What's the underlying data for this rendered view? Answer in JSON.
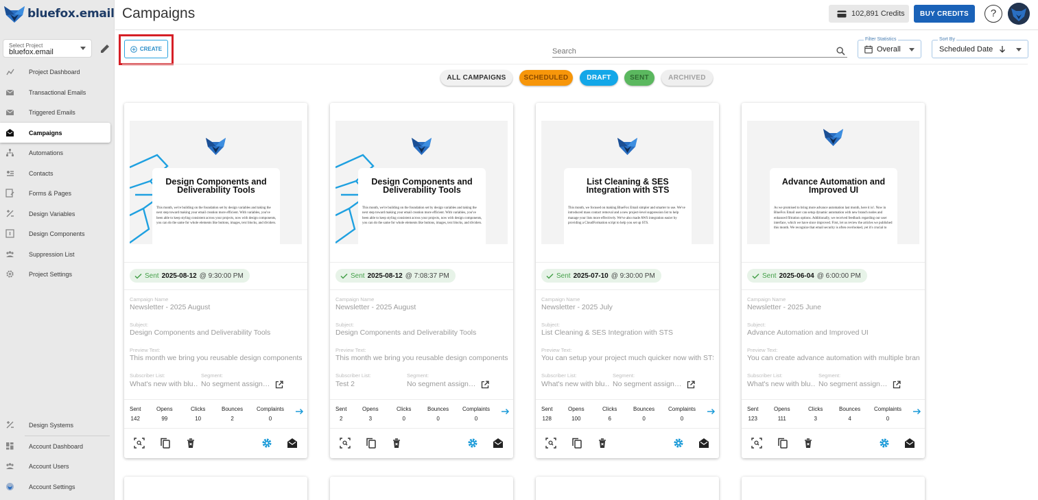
{
  "app": {
    "logo_text": "bluefox.email",
    "page_title": "Campaigns"
  },
  "project": {
    "label": "Select Project",
    "value": "bluefox.email"
  },
  "sidebar": {
    "items": [
      {
        "label": "Project Dashboard",
        "icon": "dashboard-icon"
      },
      {
        "label": "Transactional Emails",
        "icon": "mail-icon"
      },
      {
        "label": "Triggered Emails",
        "icon": "triggered-mail-icon"
      },
      {
        "label": "Campaigns",
        "icon": "campaign-icon",
        "active": true
      },
      {
        "label": "Automations",
        "icon": "flow-icon"
      },
      {
        "label": "Contacts",
        "icon": "contacts-icon"
      },
      {
        "label": "Forms & Pages",
        "icon": "forms-icon"
      },
      {
        "label": "Design Variables",
        "icon": "design-variables-icon"
      },
      {
        "label": "Design Components",
        "icon": "components-icon"
      },
      {
        "label": "Suppression List",
        "icon": "suppression-icon"
      },
      {
        "label": "Project Settings",
        "icon": "gear-icon"
      }
    ],
    "bottom_items": [
      {
        "label": "Design Systems",
        "icon": "design-systems-icon"
      },
      {
        "label": "Account Dashboard",
        "icon": "grid-icon"
      },
      {
        "label": "Account Users",
        "icon": "users-icon"
      },
      {
        "label": "Account Settings",
        "icon": "account-settings-icon"
      }
    ]
  },
  "topbar": {
    "credits": "102,891 Credits",
    "buy_label": "BUY CREDITS",
    "help": "?"
  },
  "toolbar": {
    "create_label": "CREATE",
    "search_placeholder": "Search",
    "filter_label": "Filter Statistics",
    "filter_value": "Overall",
    "sort_label": "Sort By",
    "sort_value": "Scheduled Date"
  },
  "chips": [
    {
      "label": "ALL CAMPAIGNS",
      "bg": "#f1f1f1",
      "fg": "#333333"
    },
    {
      "label": "SCHEDULED",
      "bg": "#f7960a",
      "fg": "#8a4a00"
    },
    {
      "label": "DRAFT",
      "bg": "#13a7e8",
      "fg": "#ffffff"
    },
    {
      "label": "SENT",
      "bg": "#5bb85f",
      "fg": "#2e6a31"
    },
    {
      "label": "ARCHIVED",
      "bg": "#efefef",
      "fg": "#a0a0a0"
    }
  ],
  "field_labels": {
    "campaign_name": "Campaign Name",
    "subject": "Subject:",
    "preview_text": "Preview Text:",
    "subscriber_list": "Subscriber List:",
    "segment": "Segment:"
  },
  "stat_labels": [
    "Sent",
    "Opens",
    "Clicks",
    "Bounces",
    "Complaints"
  ],
  "cards": [
    {
      "thumb_title": "Design Components and Deliverability Tools",
      "thumb_body": "This month, we're building on the foundation set by design variables and taking the next step toward making your email creation more efficient. With variables, you've been able to keep styling consistent across your projects, now with design components, you can do the same for whole elements like buttons, images, text blocks, and dividers.",
      "status": "Sent",
      "date": "2025-08-12",
      "time": "@ 9:30:00 PM",
      "name": "Newsletter - 2025 August",
      "subject": "Design Components and Deliverability Tools",
      "preview": "This month we bring you reusable design components",
      "list": "What's new with blu…",
      "segment": "No segment assign…",
      "stats": [
        "142",
        "99",
        "10",
        "2",
        "0"
      ]
    },
    {
      "thumb_title": "Design Components and Deliverability Tools",
      "thumb_body": "This month, we're building on the foundation set by design variables and taking the next step toward making your email creation more efficient. With variables, you've been able to keep styling consistent across your projects, now with design components, you can do the same for whole elements like buttons, images, text blocks, and dividers.",
      "status": "Sent",
      "date": "2025-08-12",
      "time": "@ 7:08:37 PM",
      "name": "Newsletter - 2025 August",
      "subject": "Design Components and Deliverability Tools",
      "preview": "This month we bring you reusable design components",
      "list": "Test 2",
      "segment": "No segment assign…",
      "stats": [
        "2",
        "3",
        "0",
        "0",
        "0"
      ]
    },
    {
      "thumb_title": "List Cleaning & SES Integration with STS",
      "thumb_body": "This month, we focused on making BlueFox Email simpler and smarter to use. We've introduced mass contact removal and a new project-level suppression list to help manage your lists more effectively. We've also made AWS integration easier by providing a CloudFormation script to help you set up STS.",
      "status": "Sent",
      "date": "2025-07-10",
      "time": "@ 9:30:00 PM",
      "name": "Newsletter - 2025 July",
      "subject": "List Cleaning & SES Integration with STS",
      "preview": "You can setup your project much quicker now with STS",
      "list": "What's new with blu…",
      "segment": "No segment assign…",
      "stats": [
        "128",
        "100",
        "6",
        "0",
        "0"
      ]
    },
    {
      "thumb_title": "Advance Automation and Improved UI",
      "thumb_body": "As we promised to bring more advance automation last month, here it is!. Now in BlueFox Email user can setup dynamic automation with new branch nodes and enhanced filtration options. Additionally, we received feedback regarding our user interface, which we have since improved. First, let us review the articles we published this month. We recognize that email security is often overlooked, yet it's crucial to",
      "status": "Sent",
      "date": "2025-06-04",
      "time": "@ 6:00:00 PM",
      "name": "Newsletter - 2025 June",
      "subject": "Advance Automation and Improved UI",
      "preview": "You can create advance automation with multiple branches",
      "list": "What's new with blu…",
      "segment": "No segment assign…",
      "stats": [
        "123",
        "111",
        "3",
        "4",
        "0"
      ]
    }
  ]
}
